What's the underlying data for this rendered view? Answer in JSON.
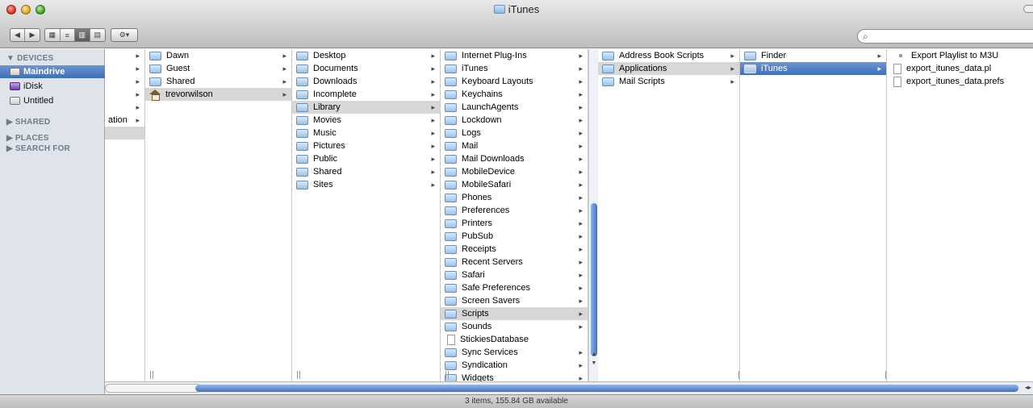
{
  "window": {
    "title": "iTunes"
  },
  "toolbar": {
    "back": "◀",
    "forward": "▶",
    "view_icon": "icon-view-icon",
    "view_list": "list-view-icon",
    "view_column": "column-view-icon",
    "view_coverflow": "coverflow-view-icon",
    "action": "gear-icon",
    "search_placeholder": ""
  },
  "sidebar": {
    "sections": [
      "▼ DEVICES",
      "▶ SHARED",
      "▶ PLACES",
      "▶ SEARCH FOR"
    ],
    "devices": [
      {
        "label": "Maindrive",
        "icon": "drive-icon",
        "selected": true
      },
      {
        "label": "iDisk",
        "icon": "idisk-icon",
        "selected": false
      },
      {
        "label": "Untitled",
        "icon": "drive-icon",
        "selected": false
      }
    ]
  },
  "columns": {
    "col0": {
      "visible_text": "ation"
    },
    "col1": [
      {
        "label": "Dawn",
        "type": "folder",
        "arrow": true
      },
      {
        "label": "Guest",
        "type": "folder",
        "arrow": true
      },
      {
        "label": "Shared",
        "type": "folder",
        "arrow": true
      },
      {
        "label": "trevorwilson",
        "type": "home",
        "arrow": true,
        "selected": true
      }
    ],
    "col2": [
      {
        "label": "Desktop",
        "arrow": true
      },
      {
        "label": "Documents",
        "arrow": true
      },
      {
        "label": "Downloads",
        "arrow": true
      },
      {
        "label": "Incomplete",
        "arrow": true
      },
      {
        "label": "Library",
        "arrow": true,
        "selected": true
      },
      {
        "label": "Movies",
        "arrow": true
      },
      {
        "label": "Music",
        "arrow": true
      },
      {
        "label": "Pictures",
        "arrow": true
      },
      {
        "label": "Public",
        "arrow": true
      },
      {
        "label": "Shared",
        "arrow": true
      },
      {
        "label": "Sites",
        "arrow": true
      }
    ],
    "col3": [
      {
        "label": "Internet Plug-Ins",
        "arrow": true
      },
      {
        "label": "iTunes",
        "arrow": true
      },
      {
        "label": "Keyboard Layouts",
        "arrow": true
      },
      {
        "label": "Keychains",
        "arrow": true
      },
      {
        "label": "LaunchAgents",
        "arrow": true
      },
      {
        "label": "Lockdown",
        "arrow": true
      },
      {
        "label": "Logs",
        "arrow": true
      },
      {
        "label": "Mail",
        "arrow": true
      },
      {
        "label": "Mail Downloads",
        "arrow": true
      },
      {
        "label": "MobileDevice",
        "arrow": true
      },
      {
        "label": "MobileSafari",
        "arrow": true
      },
      {
        "label": "Phones",
        "arrow": true
      },
      {
        "label": "Preferences",
        "arrow": true
      },
      {
        "label": "Printers",
        "arrow": true
      },
      {
        "label": "PubSub",
        "arrow": true
      },
      {
        "label": "Receipts",
        "arrow": true
      },
      {
        "label": "Recent Servers",
        "arrow": true
      },
      {
        "label": "Safari",
        "arrow": true
      },
      {
        "label": "Safe Preferences",
        "arrow": true
      },
      {
        "label": "Screen Savers",
        "arrow": true
      },
      {
        "label": "Scripts",
        "arrow": true,
        "selected": true
      },
      {
        "label": "Sounds",
        "arrow": true
      },
      {
        "label": "StickiesDatabase",
        "arrow": false,
        "type": "document"
      },
      {
        "label": "Sync Services",
        "arrow": true
      },
      {
        "label": "Syndication",
        "arrow": true
      },
      {
        "label": "Widgets",
        "arrow": true
      }
    ],
    "col4": [
      {
        "label": "Address Book Scripts",
        "arrow": true
      },
      {
        "label": "Applications",
        "arrow": true,
        "selected": true
      },
      {
        "label": "Mail Scripts",
        "arrow": true
      }
    ],
    "col5": [
      {
        "label": "Finder",
        "arrow": true
      },
      {
        "label": "iTunes",
        "arrow": true,
        "active": true
      }
    ],
    "col6": [
      {
        "label": "Export Playlist to M3U",
        "type": "script"
      },
      {
        "label": "export_itunes_data.pl",
        "type": "document"
      },
      {
        "label": "export_itunes_data.prefs",
        "type": "document"
      }
    ]
  },
  "status": {
    "text": "3 items, 155.84 GB available"
  }
}
